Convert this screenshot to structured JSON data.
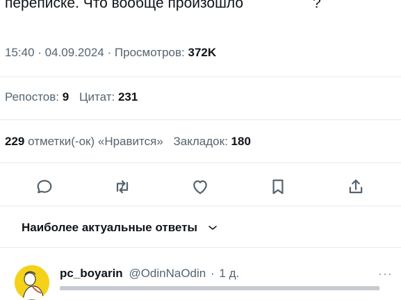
{
  "tweet": {
    "text_start": "переписке. Что вообще произошло",
    "text_end": "?"
  },
  "meta": {
    "time": "15:40",
    "date": "04.09.2024",
    "views_label": "Просмотров:",
    "views_value": "372K"
  },
  "stats": {
    "reposts_label": "Репостов:",
    "reposts_value": "9",
    "quotes_label": "Цитат:",
    "quotes_value": "231",
    "likes_value": "229",
    "likes_label": "отметки(-ок) «Нравится»",
    "bookmarks_label": "Закладок:",
    "bookmarks_value": "180"
  },
  "actions": {
    "icons": [
      "reply-icon",
      "repost-icon",
      "like-icon",
      "bookmark-icon",
      "share-icon"
    ]
  },
  "replies_sort": {
    "label": "Наиболее актуальные ответы"
  },
  "reply": {
    "name": "pc_boyarin",
    "handle": "@OdinNaOdin",
    "separator": "·",
    "time": "1 д.",
    "more": "···"
  },
  "colors": {
    "text": "#0f1419",
    "secondary": "#536471",
    "divider": "#e6e9eb",
    "avatar_bg": "#f4d21a"
  }
}
